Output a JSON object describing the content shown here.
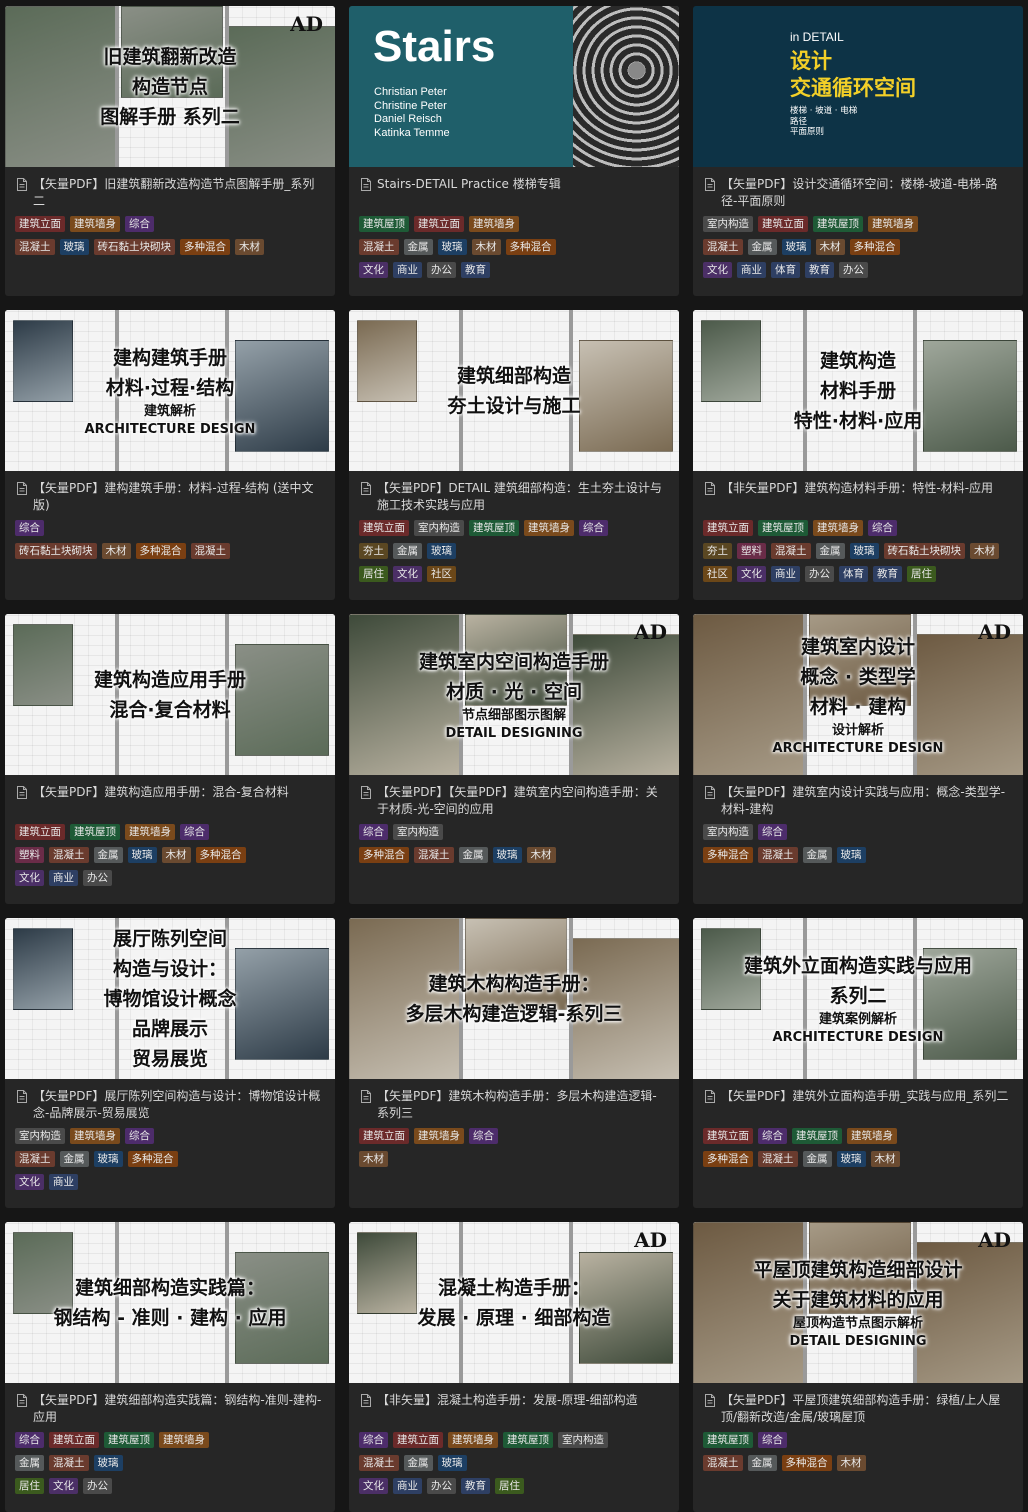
{
  "cards": [
    {
      "title": "【矢量PDF】旧建筑翻新改造构造节点图解手册_系列二",
      "cover": {
        "type": "photo",
        "lines": [
          "旧建筑翻新改造",
          "构造节点",
          "图解手册  系列二"
        ],
        "sub": [],
        "logo": "AD"
      },
      "tag_rows": [
        [
          [
            "建筑立面",
            "t-a"
          ],
          [
            "建筑墙身",
            "t-b"
          ],
          [
            "综合",
            "t-c"
          ]
        ],
        [
          [
            "混凝土",
            "t-m"
          ],
          [
            "玻璃",
            "t-f"
          ],
          [
            "砖石黏土块砌块",
            "t-m"
          ],
          [
            "多种混合",
            "t-x"
          ],
          [
            "木材",
            "t-w"
          ]
        ]
      ]
    },
    {
      "title": "Stairs-DETAIL Practice 楼梯专辑",
      "cover": {
        "type": "stairs",
        "big": "Stairs",
        "authors": "Christian Peter\nChristine Peter\nDaniel Reisch\nKatinka Temme"
      },
      "tag_rows": [
        [
          [
            "建筑屋顶",
            "t-d"
          ],
          [
            "建筑立面",
            "t-a"
          ],
          [
            "建筑墙身",
            "t-b"
          ]
        ],
        [
          [
            "混凝土",
            "t-m"
          ],
          [
            "金属",
            "t-g"
          ],
          [
            "玻璃",
            "t-f"
          ],
          [
            "木材",
            "t-w"
          ],
          [
            "多种混合",
            "t-x"
          ]
        ],
        [
          [
            "文化",
            "t-u"
          ],
          [
            "商业",
            "t-v"
          ],
          [
            "办公",
            "t-o"
          ],
          [
            "教育",
            "t-v"
          ]
        ]
      ]
    },
    {
      "title": "【矢量PDF】设计交通循环空间：楼梯-坡道-电梯-路径-平面原则",
      "cover": {
        "type": "detail",
        "top": "in DETAIL",
        "title": "设计\n交通循环空间",
        "small": "楼梯 · 坡道 · 电梯\n路径\n平面原则"
      },
      "tag_rows": [
        [
          [
            "室内构造",
            "t-e"
          ],
          [
            "建筑立面",
            "t-a"
          ],
          [
            "建筑屋顶",
            "t-d"
          ],
          [
            "建筑墙身",
            "t-b"
          ]
        ],
        [
          [
            "混凝土",
            "t-m"
          ],
          [
            "金属",
            "t-g"
          ],
          [
            "玻璃",
            "t-f"
          ],
          [
            "木材",
            "t-w"
          ],
          [
            "多种混合",
            "t-x"
          ]
        ],
        [
          [
            "文化",
            "t-u"
          ],
          [
            "商业",
            "t-v"
          ],
          [
            "体育",
            "t-v"
          ],
          [
            "教育",
            "t-v"
          ],
          [
            "办公",
            "t-o"
          ]
        ]
      ]
    },
    {
      "title": "【矢量PDF】建构建筑手册：材料-过程-结构 (送中文版)",
      "cover": {
        "type": "drawing",
        "lines": [
          "建构建筑手册",
          "材料·过程·结构"
        ],
        "sub": [
          "建筑解析",
          "ARCHITECTURE DESIGN"
        ],
        "logo": ""
      },
      "tag_rows": [
        [
          [
            "综合",
            "t-c"
          ]
        ],
        [
          [
            "砖石黏土块砌块",
            "t-m"
          ],
          [
            "木材",
            "t-w"
          ],
          [
            "多种混合",
            "t-x"
          ],
          [
            "混凝土",
            "t-m"
          ]
        ]
      ]
    },
    {
      "title": "【矢量PDF】DETAIL 建筑细部构造：生土夯土设计与施工技术实践与应用",
      "cover": {
        "type": "drawing",
        "lines": [
          "建筑细部构造",
          "夯土设计与施工"
        ],
        "sub": [],
        "logo": ""
      },
      "tag_rows": [
        [
          [
            "建筑立面",
            "t-a"
          ],
          [
            "室内构造",
            "t-e"
          ],
          [
            "建筑屋顶",
            "t-d"
          ],
          [
            "建筑墙身",
            "t-b"
          ],
          [
            "综合",
            "t-c"
          ]
        ],
        [
          [
            "夯土",
            "t-s"
          ],
          [
            "金属",
            "t-g"
          ],
          [
            "玻璃",
            "t-f"
          ]
        ],
        [
          [
            "居住",
            "t-h"
          ],
          [
            "文化",
            "t-u"
          ],
          [
            "社区",
            "t-z"
          ]
        ]
      ]
    },
    {
      "title": "【非矢量PDF】建筑构造材料手册：特性-材料-应用",
      "cover": {
        "type": "drawing",
        "lines": [
          "建筑构造",
          "材料手册",
          "特性·材料·应用"
        ],
        "sub": [],
        "logo": ""
      },
      "tag_rows": [
        [
          [
            "建筑立面",
            "t-a"
          ],
          [
            "建筑屋顶",
            "t-d"
          ],
          [
            "建筑墙身",
            "t-b"
          ],
          [
            "综合",
            "t-c"
          ]
        ],
        [
          [
            "夯土",
            "t-s"
          ],
          [
            "塑料",
            "t-p"
          ],
          [
            "混凝土",
            "t-m"
          ],
          [
            "金属",
            "t-g"
          ],
          [
            "玻璃",
            "t-f"
          ],
          [
            "砖石黏土块砌块",
            "t-m"
          ],
          [
            "木材",
            "t-w"
          ]
        ],
        [
          [
            "社区",
            "t-z"
          ],
          [
            "文化",
            "t-u"
          ],
          [
            "商业",
            "t-v"
          ],
          [
            "办公",
            "t-o"
          ],
          [
            "体育",
            "t-v"
          ],
          [
            "教育",
            "t-v"
          ],
          [
            "居住",
            "t-h"
          ]
        ]
      ]
    },
    {
      "title": "【矢量PDF】建筑构造应用手册：混合-复合材料",
      "cover": {
        "type": "drawing",
        "lines": [
          "建筑构造应用手册",
          "混合·复合材料"
        ],
        "sub": [],
        "logo": ""
      },
      "tag_rows": [
        [
          [
            "建筑立面",
            "t-a"
          ],
          [
            "建筑屋顶",
            "t-d"
          ],
          [
            "建筑墙身",
            "t-b"
          ],
          [
            "综合",
            "t-c"
          ]
        ],
        [
          [
            "塑料",
            "t-p"
          ],
          [
            "混凝土",
            "t-m"
          ],
          [
            "金属",
            "t-g"
          ],
          [
            "玻璃",
            "t-f"
          ],
          [
            "木材",
            "t-w"
          ],
          [
            "多种混合",
            "t-x"
          ]
        ],
        [
          [
            "文化",
            "t-u"
          ],
          [
            "商业",
            "t-v"
          ],
          [
            "办公",
            "t-o"
          ]
        ]
      ]
    },
    {
      "title": "【矢量PDF】【矢量PDF】建筑室内空间构造手册：关于材质-光-空间的应用",
      "cover": {
        "type": "photo",
        "lines": [
          "建筑室内空间构造手册",
          "材质 · 光 · 空间"
        ],
        "sub": [
          "节点细部图示图解",
          "DETAIL DESIGNING"
        ],
        "logo": "AD"
      },
      "tag_rows": [
        [
          [
            "综合",
            "t-c"
          ],
          [
            "室内构造",
            "t-e"
          ]
        ],
        [
          [
            "多种混合",
            "t-x"
          ],
          [
            "混凝土",
            "t-m"
          ],
          [
            "金属",
            "t-g"
          ],
          [
            "玻璃",
            "t-f"
          ],
          [
            "木材",
            "t-w"
          ]
        ]
      ]
    },
    {
      "title": "【矢量PDF】建筑室内设计实践与应用：概念-类型学-材料-建构",
      "cover": {
        "type": "photo",
        "lines": [
          "建筑室内设计",
          "概念 · 类型学",
          "材料 · 建构"
        ],
        "sub": [
          "设计解析",
          "ARCHITECTURE DESIGN"
        ],
        "logo": "AD"
      },
      "tag_rows": [
        [
          [
            "室内构造",
            "t-e"
          ],
          [
            "综合",
            "t-c"
          ]
        ],
        [
          [
            "多种混合",
            "t-x"
          ],
          [
            "混凝土",
            "t-m"
          ],
          [
            "金属",
            "t-g"
          ],
          [
            "玻璃",
            "t-f"
          ]
        ]
      ]
    },
    {
      "title": "【矢量PDF】展厅陈列空间构造与设计：博物馆设计概念-品牌展示-贸易展览",
      "cover": {
        "type": "drawing",
        "lines": [
          "展厅陈列空间",
          "构造与设计：",
          "博物馆设计概念",
          "品牌展示",
          "贸易展览"
        ],
        "sub": [],
        "logo": ""
      },
      "tag_rows": [
        [
          [
            "室内构造",
            "t-e"
          ],
          [
            "建筑墙身",
            "t-b"
          ],
          [
            "综合",
            "t-c"
          ]
        ],
        [
          [
            "混凝土",
            "t-m"
          ],
          [
            "金属",
            "t-g"
          ],
          [
            "玻璃",
            "t-f"
          ],
          [
            "多种混合",
            "t-x"
          ]
        ],
        [
          [
            "文化",
            "t-u"
          ],
          [
            "商业",
            "t-v"
          ]
        ]
      ]
    },
    {
      "title": "【矢量PDF】建筑木构构造手册：多层木构建造逻辑-系列三",
      "cover": {
        "type": "photo",
        "lines": [
          "建筑木构构造手册：",
          "多层木构建造逻辑-系列三"
        ],
        "sub": [],
        "logo": ""
      },
      "tag_rows": [
        [
          [
            "建筑立面",
            "t-a"
          ],
          [
            "建筑墙身",
            "t-b"
          ],
          [
            "综合",
            "t-c"
          ]
        ],
        [
          [
            "木材",
            "t-w"
          ]
        ]
      ]
    },
    {
      "title": "【矢量PDF】建筑外立面构造手册_实践与应用_系列二",
      "cover": {
        "type": "drawing",
        "lines": [
          "建筑外立面构造实践与应用",
          "系列二"
        ],
        "sub": [
          "建筑案例解析",
          "ARCHITECTURE DESIGN"
        ],
        "logo": ""
      },
      "tag_rows": [
        [
          [
            "建筑立面",
            "t-a"
          ],
          [
            "综合",
            "t-c"
          ],
          [
            "建筑屋顶",
            "t-d"
          ],
          [
            "建筑墙身",
            "t-b"
          ]
        ],
        [
          [
            "多种混合",
            "t-x"
          ],
          [
            "混凝土",
            "t-m"
          ],
          [
            "金属",
            "t-g"
          ],
          [
            "玻璃",
            "t-f"
          ],
          [
            "木材",
            "t-w"
          ]
        ]
      ]
    },
    {
      "title": "【矢量PDF】建筑细部构造实践篇：钢结构-准则-建构-应用",
      "cover": {
        "type": "drawing",
        "lines": [
          "建筑细部构造实践篇：",
          "钢结构 - 准则 · 建构 · 应用"
        ],
        "sub": [],
        "logo": ""
      },
      "tag_rows": [
        [
          [
            "综合",
            "t-c"
          ],
          [
            "建筑立面",
            "t-a"
          ],
          [
            "建筑屋顶",
            "t-d"
          ],
          [
            "建筑墙身",
            "t-b"
          ]
        ],
        [
          [
            "金属",
            "t-g"
          ],
          [
            "混凝土",
            "t-m"
          ],
          [
            "玻璃",
            "t-f"
          ]
        ],
        [
          [
            "居住",
            "t-h"
          ],
          [
            "文化",
            "t-u"
          ],
          [
            "办公",
            "t-o"
          ]
        ]
      ]
    },
    {
      "title": "【非矢量】混凝土构造手册：发展-原理-细部构造",
      "cover": {
        "type": "drawing",
        "lines": [
          "混凝土构造手册：",
          "发展 · 原理 · 细部构造"
        ],
        "sub": [],
        "logo": "AD"
      },
      "tag_rows": [
        [
          [
            "综合",
            "t-c"
          ],
          [
            "建筑立面",
            "t-a"
          ],
          [
            "建筑墙身",
            "t-b"
          ],
          [
            "建筑屋顶",
            "t-d"
          ],
          [
            "室内构造",
            "t-e"
          ]
        ],
        [
          [
            "混凝土",
            "t-m"
          ],
          [
            "金属",
            "t-g"
          ],
          [
            "玻璃",
            "t-f"
          ]
        ],
        [
          [
            "文化",
            "t-u"
          ],
          [
            "商业",
            "t-v"
          ],
          [
            "办公",
            "t-o"
          ],
          [
            "教育",
            "t-v"
          ],
          [
            "居住",
            "t-h"
          ]
        ]
      ]
    },
    {
      "title": "【矢量PDF】平屋顶建筑细部构造手册：绿植/上人屋顶/翻新改造/金属/玻璃屋顶",
      "cover": {
        "type": "photo",
        "lines": [
          "平屋顶建筑构造细部设计",
          "关于建筑材料的应用"
        ],
        "sub": [
          "屋顶构造节点图示解析",
          "DETAIL DESIGNING"
        ],
        "logo": "AD"
      },
      "tag_rows": [
        [
          [
            "建筑屋顶",
            "t-d"
          ],
          [
            "综合",
            "t-c"
          ]
        ],
        [
          [
            "混凝土",
            "t-m"
          ],
          [
            "金属",
            "t-g"
          ],
          [
            "多种混合",
            "t-x"
          ],
          [
            "木材",
            "t-w"
          ]
        ]
      ]
    }
  ]
}
